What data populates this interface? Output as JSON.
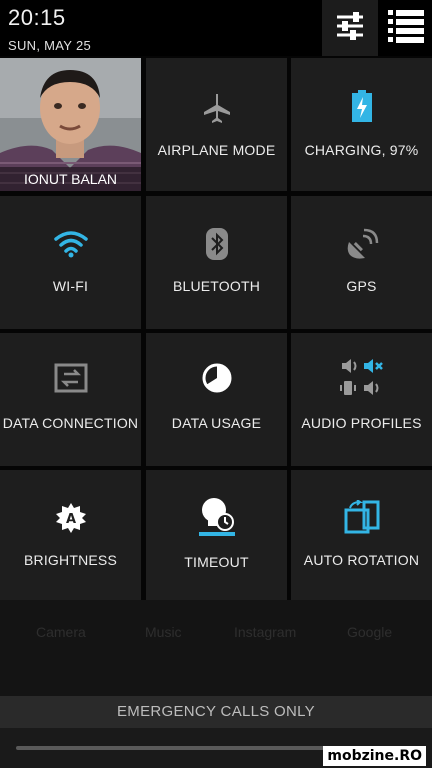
{
  "status": {
    "time": "20:15",
    "date": "SUN, MAY 25"
  },
  "header_icons": [
    "settings-sliders-icon",
    "list-icon"
  ],
  "user": {
    "name": "IONUT BALAN"
  },
  "tiles": [
    {
      "label": "AIRPLANE MODE",
      "icon": "airplane-icon"
    },
    {
      "label": "CHARGING, 97%",
      "icon": "battery-charging-icon",
      "level": 97
    },
    {
      "label": "WI-FI",
      "icon": "wifi-icon"
    },
    {
      "label": "BLUETOOTH",
      "icon": "bluetooth-icon"
    },
    {
      "label": "GPS",
      "icon": "gps-icon"
    },
    {
      "label": "DATA CONNECTION",
      "icon": "data-connection-icon"
    },
    {
      "label": "DATA USAGE",
      "icon": "data-usage-icon"
    },
    {
      "label": "AUDIO PROFILES",
      "icon": "audio-profiles-icon"
    },
    {
      "label": "BRIGHTNESS",
      "icon": "brightness-auto-icon"
    },
    {
      "label": "TIMEOUT",
      "icon": "timeout-icon"
    },
    {
      "label": "AUTO ROTATION",
      "icon": "auto-rotation-icon"
    }
  ],
  "background_apps": [
    "Camera",
    "Music",
    "Instagram",
    "Google"
  ],
  "emergency": "EMERGENCY CALLS ONLY",
  "watermark": "mobzine.RO",
  "colors": {
    "accent": "#33b5e5",
    "tile": "#1e1e1e",
    "header": "#000000"
  }
}
